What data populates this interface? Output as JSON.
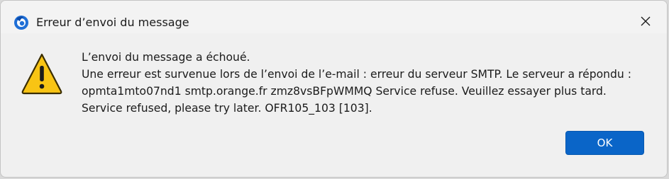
{
  "window": {
    "title": "Erreur d’envoi du message",
    "app_icon": "thunderbird-app-icon",
    "close_icon": "close-icon"
  },
  "message": {
    "icon": "warning-icon",
    "lines": [
      "L’envoi du message a échoué.",
      "Une erreur est survenue lors de l’envoi de l’e-mail : erreur du serveur SMTP. Le serveur a répondu :",
      "opmta1mto07nd1 smtp.orange.fr zmz8vsBFpWMMQ Service refuse. Veuillez essayer plus tard.",
      "Service refused, please try later. OFR105_103  [103]."
    ]
  },
  "buttons": {
    "ok_label": "OK"
  },
  "colors": {
    "accent": "#0a65c8",
    "warning_fill": "#f8c414",
    "dialog_bg": "#f0f0f0"
  }
}
